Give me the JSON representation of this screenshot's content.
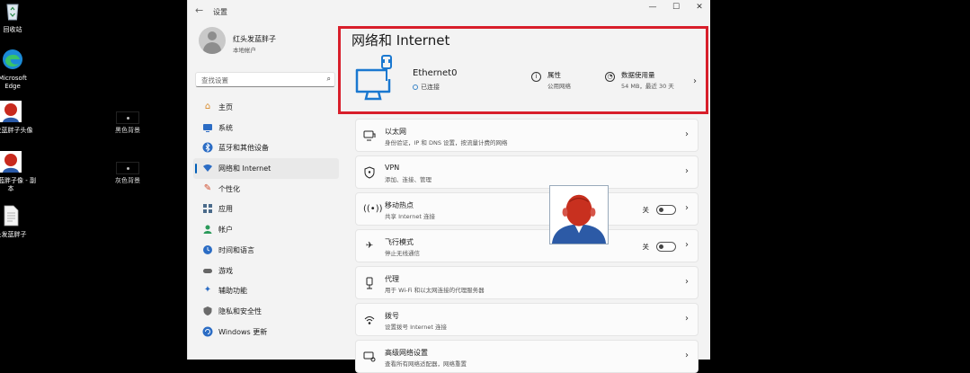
{
  "desktop": {
    "icons": [
      {
        "label": "回收站"
      },
      {
        "label": "Microsoft Edge"
      },
      {
        "label": "头发蓝胖子头像"
      },
      {
        "label": "头发蓝胖子像 - 副本"
      },
      {
        "label": "头发蓝胖子"
      },
      {
        "label": "黑色背景"
      },
      {
        "label": "灰色背景"
      }
    ]
  },
  "window": {
    "title": "设置",
    "back_icon": "back-arrow-icon",
    "controls": {
      "minimize": "—",
      "maximize": "☐",
      "close": "✕"
    }
  },
  "sidebar": {
    "user": {
      "name": "红头发蓝胖子",
      "subtitle": "本地帐户"
    },
    "search": {
      "placeholder": "查找设置"
    },
    "items": [
      {
        "label": "主页",
        "icon": "home-icon",
        "color": "#d88a2a"
      },
      {
        "label": "系统",
        "icon": "system-icon",
        "color": "#2b6cc4"
      },
      {
        "label": "蓝牙和其他设备",
        "icon": "bluetooth-icon",
        "color": "#2b6cc4"
      },
      {
        "label": "网络和 Internet",
        "icon": "network-icon",
        "color": "#2b6cc4",
        "active": true
      },
      {
        "label": "个性化",
        "icon": "personalization-icon",
        "color": "#d04a2a"
      },
      {
        "label": "应用",
        "icon": "apps-icon",
        "color": "#4a6a8a"
      },
      {
        "label": "帐户",
        "icon": "accounts-icon",
        "color": "#2b9a5a"
      },
      {
        "label": "时间和语言",
        "icon": "time-language-icon",
        "color": "#2b6cc4"
      },
      {
        "label": "游戏",
        "icon": "gaming-icon",
        "color": "#666666"
      },
      {
        "label": "辅助功能",
        "icon": "accessibility-icon",
        "color": "#2b6cc4"
      },
      {
        "label": "隐私和安全性",
        "icon": "privacy-icon",
        "color": "#6a6a6a"
      },
      {
        "label": "Windows 更新",
        "icon": "windows-update-icon",
        "color": "#2b6cc4"
      }
    ]
  },
  "main": {
    "page_title": "网络和 Internet",
    "hero": {
      "adapter_name": "Ethernet0",
      "status": "已连接",
      "properties": {
        "title": "属性",
        "subtitle": "公用网络"
      },
      "data_usage": {
        "title": "数据使用量",
        "subtitle": "54 MB，最近 30 天"
      }
    },
    "cards": [
      {
        "title": "以太网",
        "subtitle": "身份验证，IP 和 DNS 设置，按流量计费的网络",
        "icon": "ethernet-icon"
      },
      {
        "title": "VPN",
        "subtitle": "添加、连接、管理",
        "icon": "vpn-shield-icon"
      },
      {
        "title": "移动热点",
        "subtitle": "共享 Internet 连接",
        "icon": "hotspot-icon",
        "state": "关"
      },
      {
        "title": "飞行模式",
        "subtitle": "停止无线通信",
        "icon": "airplane-icon",
        "state": "关"
      },
      {
        "title": "代理",
        "subtitle": "用于 Wi-Fi 和以太网连接的代理服务器",
        "icon": "proxy-icon"
      },
      {
        "title": "拨号",
        "subtitle": "设置拨号 Internet 连接",
        "icon": "dialup-icon"
      },
      {
        "title": "高级网络设置",
        "subtitle": "查看所有网络适配器，网络重置",
        "icon": "advanced-network-icon"
      }
    ]
  },
  "colors": {
    "accent": "#005fb8",
    "highlight_box": "#d81e2a",
    "ethernet_icon": "#1a78d0"
  }
}
